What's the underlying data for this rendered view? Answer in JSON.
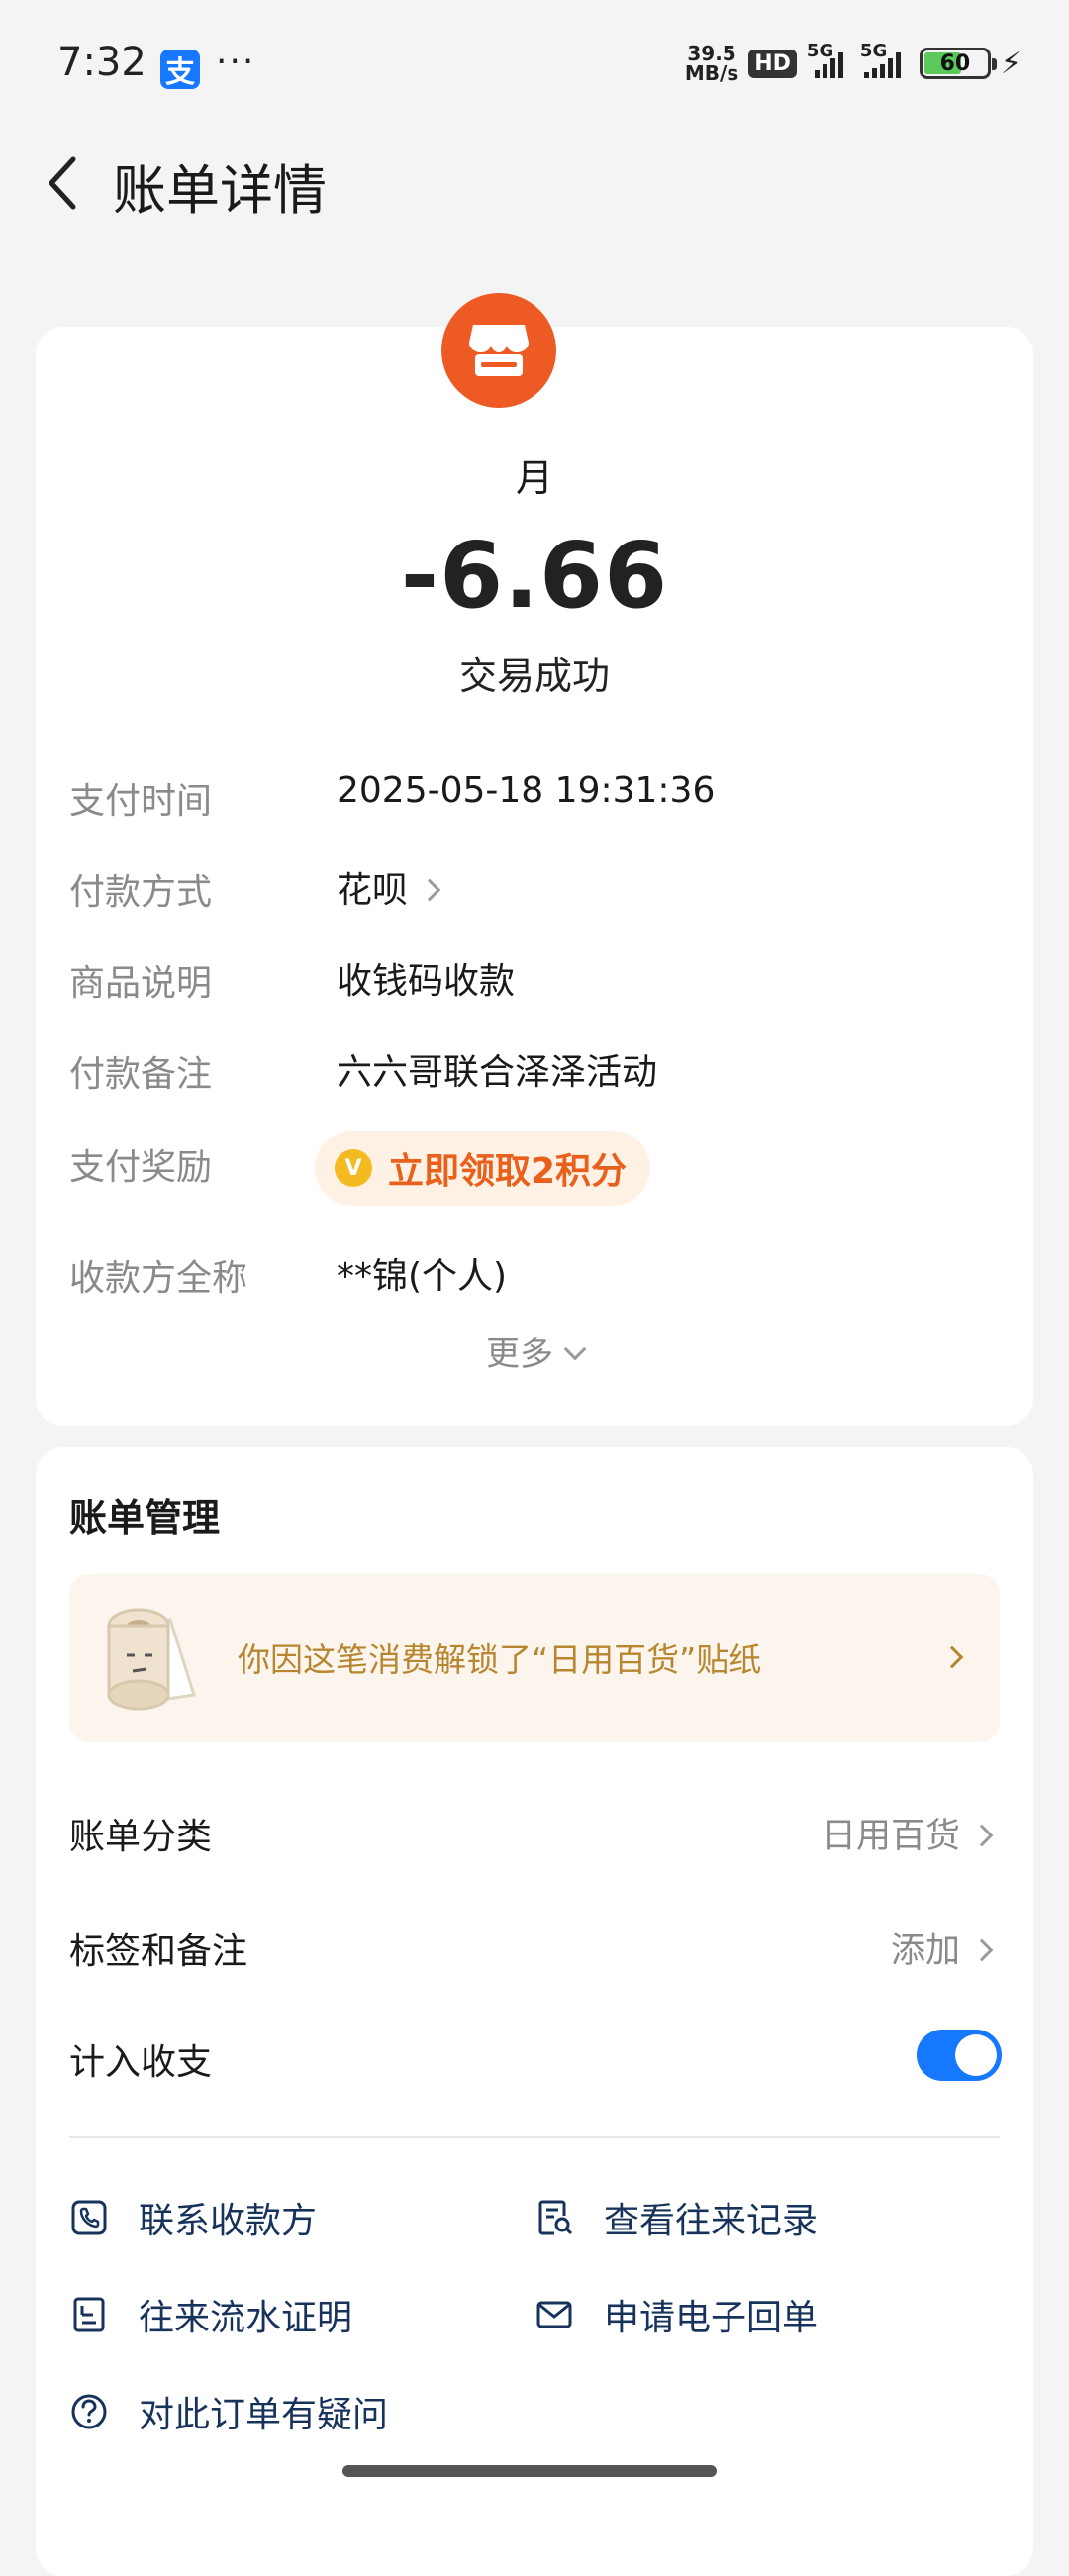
{
  "status_bar": {
    "time": "7:32",
    "app_badge": "支",
    "dots": "···",
    "net_speed_value": "39.5",
    "net_speed_unit": "MB/s",
    "hd_label": "HD",
    "sim1": "5G",
    "sim2": "5G",
    "battery": "60"
  },
  "nav": {
    "title": "账单详情"
  },
  "bill": {
    "merchant": "月",
    "amount": "-6.66",
    "status": "交易成功",
    "rows": [
      {
        "label": "支付时间",
        "value": "2025-05-18 19:31:36"
      },
      {
        "label": "付款方式",
        "value": "花呗"
      },
      {
        "label": "商品说明",
        "value": "收钱码收款"
      },
      {
        "label": "付款备注",
        "value": "六六哥联合泽泽活动"
      },
      {
        "label": "支付奖励",
        "value": "立即领取2积分"
      },
      {
        "label": "收款方全称",
        "value": "**锦(个人)"
      }
    ],
    "reward_icon_letter": "V",
    "more": "更多"
  },
  "management": {
    "title": "账单管理",
    "sticker_text": "你因这笔消费解锁了“日用百货”贴纸",
    "category_label": "账单分类",
    "category_value": "日用百货",
    "tags_label": "标签和备注",
    "tags_value": "添加",
    "include_label": "计入收支",
    "include_on": true,
    "actions": {
      "contact": "联系收款方",
      "history": "查看往来记录",
      "proof": "往来流水证明",
      "receipt": "申请电子回单",
      "question": "对此订单有疑问"
    }
  },
  "colors": {
    "accent": "#1677ff",
    "merchant_icon": "#ee5a24",
    "reward_text": "#e8601c",
    "sticker_text": "#b8862f",
    "action_text": "#17335b"
  }
}
